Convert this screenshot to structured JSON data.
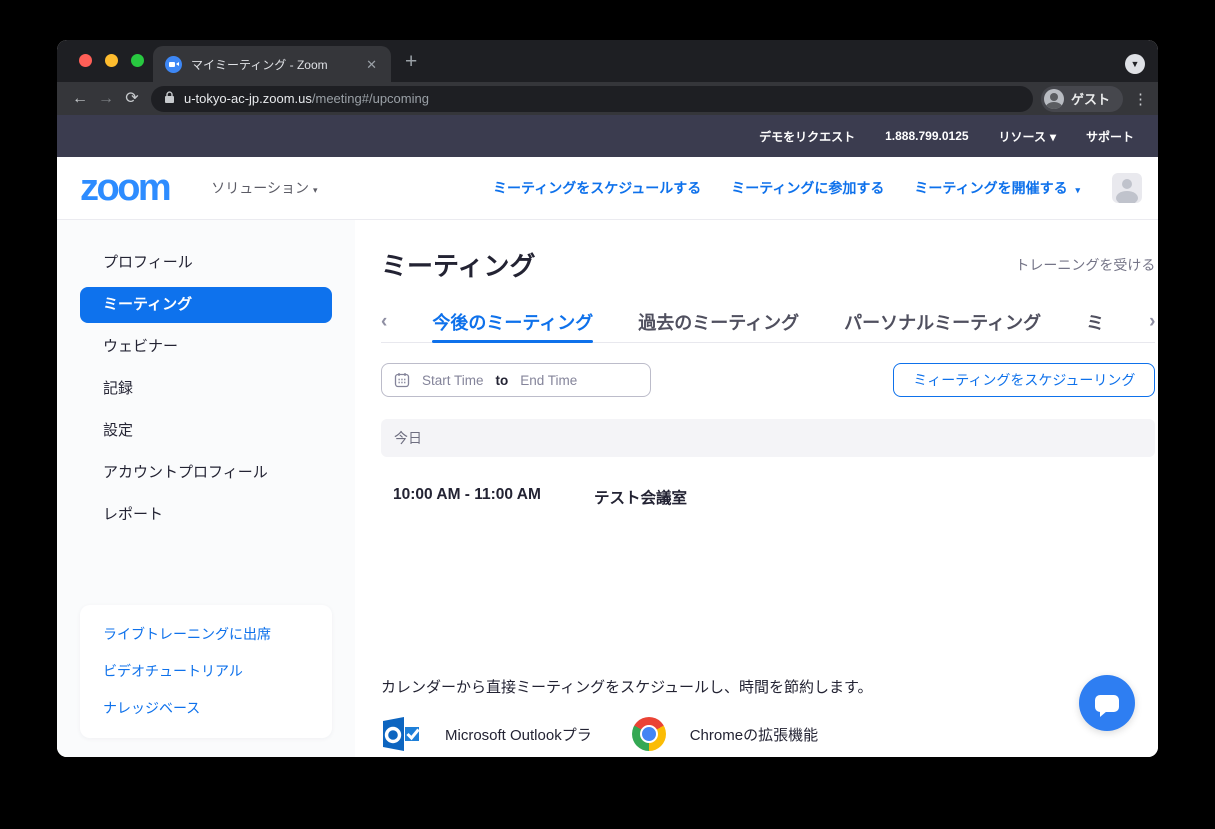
{
  "browser": {
    "tab_title": "マイミーティング - Zoom",
    "close_tab": "✕",
    "new_tab": "+",
    "back": "←",
    "forward": "→",
    "reload": "⟳",
    "lock": "🔒",
    "url_domain": "u-tokyo-ac-jp.zoom.us",
    "url_path": "/meeting#/upcoming",
    "guest_label": "ゲスト",
    "menu_dots": "⋮",
    "tab_search_chevron": "▼"
  },
  "topbar": {
    "links": [
      "デモをリクエスト",
      "1.888.799.0125",
      "リソース",
      "サポート"
    ],
    "caret": "▾"
  },
  "header": {
    "logo": "zoom",
    "solutions_label": "ソリューション",
    "caret": "▾",
    "nav": [
      "ミーティングをスケジュールする",
      "ミーティングに参加する",
      "ミーティングを開催する"
    ]
  },
  "sidebar": {
    "items": [
      "プロフィール",
      "ミーティング",
      "ウェビナー",
      "記録",
      "設定",
      "アカウントプロフィール",
      "レポート"
    ],
    "active_item": "ミーティング",
    "links": [
      "ライブトレーニングに出席",
      "ビデオチュートリアル",
      "ナレッジベース"
    ]
  },
  "main": {
    "title": "ミーティング",
    "training_link": "トレーニングを受ける",
    "tabs": [
      "今後のミーティング",
      "過去のミーティング",
      "パーソナルミーティング",
      "ミ"
    ],
    "active_tab": "今後のミーティング",
    "chevron_left": "‹",
    "chevron_right": "›",
    "filter": {
      "start_placeholder": "Start Time",
      "to_label": "to",
      "end_placeholder": "End Time"
    },
    "schedule_button": "ミィーティングをスケジューリング",
    "section_label": "今日",
    "meeting": {
      "time": "10:00 AM - 11:00 AM",
      "name": "テスト会議室"
    },
    "promo_text": "カレンダーから直接ミーティングをスケジュールし、時間を節約します。",
    "integrations": [
      {
        "name": "Microsoft Outlookプラ",
        "icon": "outlook-icon"
      },
      {
        "name": "Chromeの拡張機能",
        "icon": "chrome-icon"
      }
    ]
  },
  "colors": {
    "accent_blue": "#0e71eb",
    "logo_blue": "#2d8cff",
    "topbar_purple": "#3b3c4f",
    "sidebar_bg": "#fafbfc",
    "fab_blue": "#2e7ef2"
  }
}
